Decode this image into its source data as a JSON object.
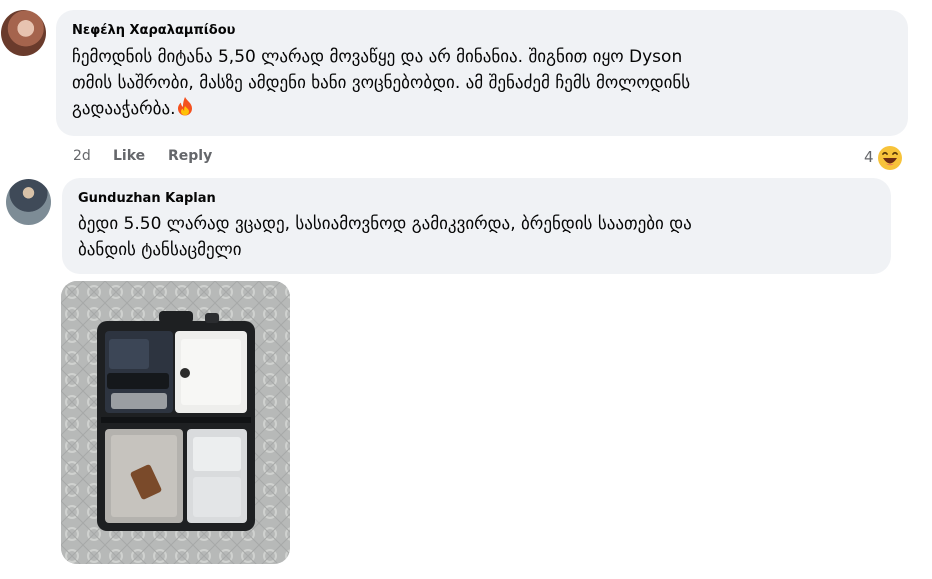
{
  "comments": [
    {
      "author": "Νεφέλη Χαραλαμπίδου",
      "lines": [
        "ჩემოდნის მიტანა 5,50 ლარად მოვაწყე და არ მინანია. შიგნით იყო Dyson",
        "თმის საშრობი, მასზე ამდენი ხანი ვოცნებობდი. ამ შენაძემ ჩემს მოლოდინს",
        "გადააჭარბა."
      ],
      "emoji": "fire-icon",
      "time": "2d",
      "like_label": "Like",
      "reply_label": "Reply",
      "reaction_count": "4",
      "reaction_emoji": "laughing-emoji-icon"
    },
    {
      "author": "Gunduzhan Kaplan",
      "lines": [
        "ბედი 5.50 ლარად ვცადე, სასიამოვნოდ გამიკვირდა, ბრენდის საათები და",
        "ბანდის ტანსაცმელი"
      ],
      "attachment": "suitcase-photo"
    }
  ]
}
